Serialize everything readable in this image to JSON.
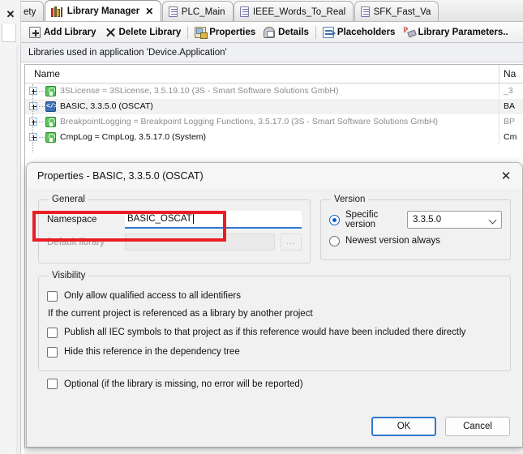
{
  "window": {
    "left_close_icon": "✕"
  },
  "tabs": [
    {
      "label": "ety",
      "icon": "",
      "active": false,
      "partial": true,
      "closable": false
    },
    {
      "label": "Library Manager",
      "icon": "books-icon",
      "active": true,
      "partial": false,
      "closable": true,
      "close_glyph": "✕"
    },
    {
      "label": "PLC_Main",
      "icon": "document-icon",
      "active": false,
      "partial": false,
      "closable": false
    },
    {
      "label": "IEEE_Words_To_Real",
      "icon": "document-icon",
      "active": false,
      "partial": false,
      "closable": false
    },
    {
      "label": "SFK_Fast_Va",
      "icon": "document-icon",
      "active": false,
      "partial": false,
      "closable": false
    }
  ],
  "toolbar": {
    "add_library": "Add Library",
    "delete_library": "Delete Library",
    "properties": "Properties",
    "details": "Details",
    "placeholders": "Placeholders",
    "library_parameters": "Library Parameters..",
    "icons": {
      "add": "add-library-icon",
      "delete": "delete-library-icon",
      "properties": "properties-icon",
      "details": "details-icon",
      "placeholders": "placeholders-icon",
      "library_parameters": "library-parameters-icon"
    }
  },
  "infobar": {
    "text": "Libraries used in application 'Device.Application'"
  },
  "grid": {
    "columns": {
      "name": "Name",
      "namespace": "Na"
    },
    "rows": [
      {
        "name": "3SLicense = 3SLicense, 3.5.19.10 (3S - Smart Software Solutions GmbH)",
        "namespace": "_3",
        "icon": "lock-icon",
        "dim": true,
        "selected": false
      },
      {
        "name": "BASIC, 3.3.5.0 (OSCAT)",
        "namespace": "BA",
        "icon": "code-icon",
        "dim": false,
        "selected": true
      },
      {
        "name": "BreakpointLogging = Breakpoint Logging Functions, 3.5.17.0 (3S - Smart Software Solutions GmbH)",
        "namespace": "BP",
        "icon": "lock-icon",
        "dim": true,
        "selected": false
      },
      {
        "name": "CmpLog = CmpLog, 3.5.17.0 (System)",
        "namespace": "Cm",
        "icon": "lock-icon",
        "dim": false,
        "selected": false
      }
    ]
  },
  "dialog": {
    "title": "Properties - BASIC, 3.3.5.0 (OSCAT)",
    "close_glyph": "✕",
    "general": {
      "legend": "General",
      "namespace_label": "Namespace",
      "namespace_value": "BASIC_OSCAT",
      "default_library_label": "Default library",
      "default_library_value": "",
      "browse_label": "..."
    },
    "version": {
      "legend": "Version",
      "specific_version_label": "Specific version",
      "specific_version_selected": true,
      "version_value": "3.3.5.0",
      "newest_version_label": "Newest version always",
      "newest_version_selected": false
    },
    "visibility": {
      "legend": "Visibility",
      "qualified_access_label": "Only allow qualified access to all identifiers",
      "qualified_access_checked": false,
      "note": "If the current project is referenced as a library by another project",
      "publish_label": "Publish all IEC symbols to that project as if this reference would have been included there directly",
      "publish_checked": false,
      "hide_label": "Hide this reference in the dependency tree",
      "hide_checked": false
    },
    "optional": {
      "label": "Optional (if the library is missing, no error will be reported)",
      "checked": false
    },
    "buttons": {
      "ok": "OK",
      "cancel": "Cancel"
    }
  },
  "annotation": {
    "color": "#ec1c24",
    "target": "namespace-field"
  }
}
